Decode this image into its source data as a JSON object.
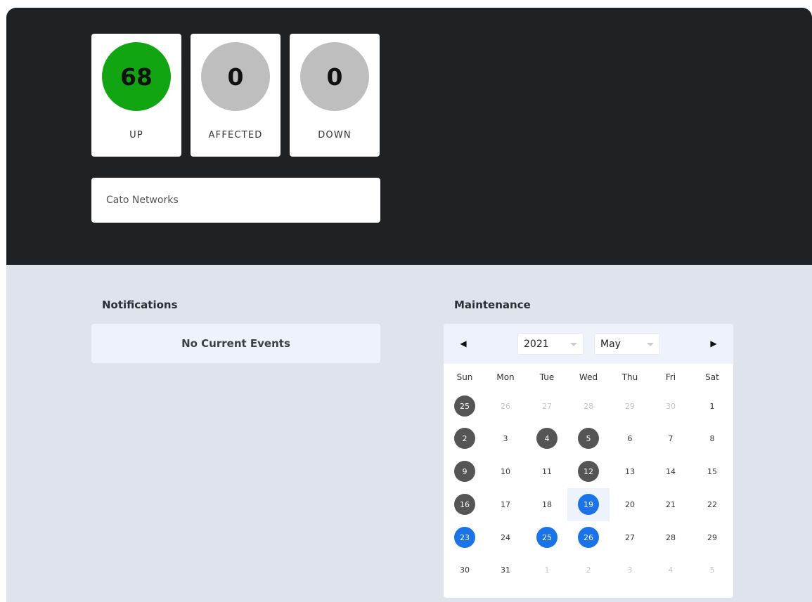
{
  "stats": {
    "up": {
      "count": "68",
      "label": "UP",
      "color": "#11a611"
    },
    "affected": {
      "count": "0",
      "label": "AFFECTED",
      "color": "#bebebe"
    },
    "down": {
      "count": "0",
      "label": "DOWN",
      "color": "#bebebe"
    }
  },
  "company": {
    "name": "Cato Networks"
  },
  "notifications": {
    "title": "Notifications",
    "empty_text": "No Current Events"
  },
  "maintenance": {
    "title": "Maintenance",
    "calendar": {
      "prev_icon": "caret-left-icon",
      "next_icon": "caret-right-icon",
      "year": "2021",
      "month": "May",
      "weekdays": [
        "Sun",
        "Mon",
        "Tue",
        "Wed",
        "Thu",
        "Fri",
        "Sat"
      ],
      "highlight_color_dark": "#555555",
      "highlight_color_blue": "#1a73e8",
      "weeks": [
        [
          {
            "d": "25",
            "s": "dark"
          },
          {
            "d": "26",
            "s": "muted"
          },
          {
            "d": "27",
            "s": "muted"
          },
          {
            "d": "28",
            "s": "muted"
          },
          {
            "d": "29",
            "s": "muted"
          },
          {
            "d": "30",
            "s": "muted"
          },
          {
            "d": "1",
            "s": ""
          }
        ],
        [
          {
            "d": "2",
            "s": "dark"
          },
          {
            "d": "3",
            "s": ""
          },
          {
            "d": "4",
            "s": "dark"
          },
          {
            "d": "5",
            "s": "dark"
          },
          {
            "d": "6",
            "s": ""
          },
          {
            "d": "7",
            "s": ""
          },
          {
            "d": "8",
            "s": ""
          }
        ],
        [
          {
            "d": "9",
            "s": "dark"
          },
          {
            "d": "10",
            "s": ""
          },
          {
            "d": "11",
            "s": ""
          },
          {
            "d": "12",
            "s": "dark"
          },
          {
            "d": "13",
            "s": ""
          },
          {
            "d": "14",
            "s": ""
          },
          {
            "d": "15",
            "s": ""
          }
        ],
        [
          {
            "d": "16",
            "s": "dark"
          },
          {
            "d": "17",
            "s": ""
          },
          {
            "d": "18",
            "s": ""
          },
          {
            "d": "19",
            "s": "blue today"
          },
          {
            "d": "20",
            "s": ""
          },
          {
            "d": "21",
            "s": ""
          },
          {
            "d": "22",
            "s": ""
          }
        ],
        [
          {
            "d": "23",
            "s": "blue"
          },
          {
            "d": "24",
            "s": ""
          },
          {
            "d": "25",
            "s": "blue"
          },
          {
            "d": "26",
            "s": "blue"
          },
          {
            "d": "27",
            "s": ""
          },
          {
            "d": "28",
            "s": ""
          },
          {
            "d": "29",
            "s": ""
          }
        ],
        [
          {
            "d": "30",
            "s": ""
          },
          {
            "d": "31",
            "s": ""
          },
          {
            "d": "1",
            "s": "muted"
          },
          {
            "d": "2",
            "s": "muted"
          },
          {
            "d": "3",
            "s": "muted"
          },
          {
            "d": "4",
            "s": "muted"
          },
          {
            "d": "5",
            "s": "muted"
          }
        ]
      ]
    }
  }
}
